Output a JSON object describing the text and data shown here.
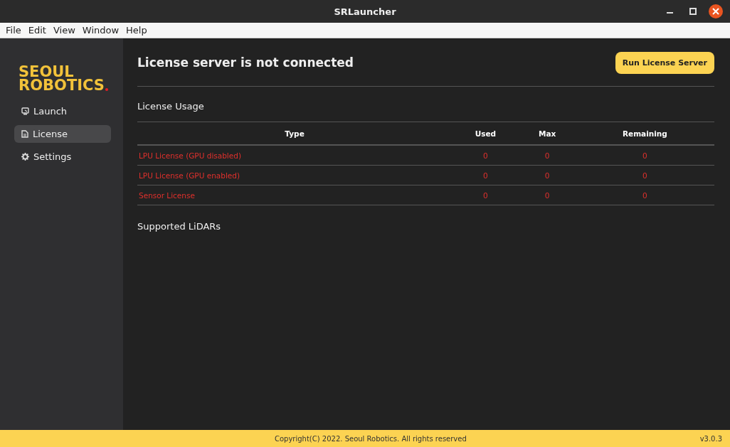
{
  "window": {
    "title": "SRLauncher"
  },
  "menu": [
    "File",
    "Edit",
    "View",
    "Window",
    "Help"
  ],
  "sidebar": {
    "logo": [
      "SEOUL",
      "ROBOTICS"
    ],
    "items": [
      {
        "label": "Launch",
        "kind": "launch",
        "selected": false
      },
      {
        "label": "License",
        "kind": "license",
        "selected": true
      },
      {
        "label": "Settings",
        "kind": "settings",
        "selected": false
      }
    ]
  },
  "header": {
    "title": "License server is not connected",
    "button": "Run License Server"
  },
  "usage": {
    "title": "License Usage",
    "columns": [
      "Type",
      "Used",
      "Max",
      "Remaining"
    ],
    "rows": [
      [
        "LPU License (GPU disabled)",
        "0",
        "0",
        "0"
      ],
      [
        "LPU License (GPU enabled)",
        "0",
        "0",
        "0"
      ],
      [
        "Sensor License",
        "0",
        "0",
        "0"
      ]
    ]
  },
  "lidars": {
    "title": "Supported LiDARs"
  },
  "footer": {
    "copyright": "Copyright(C) 2022. Seoul Robotics. All rights reserved",
    "version": "v3.0.3"
  }
}
